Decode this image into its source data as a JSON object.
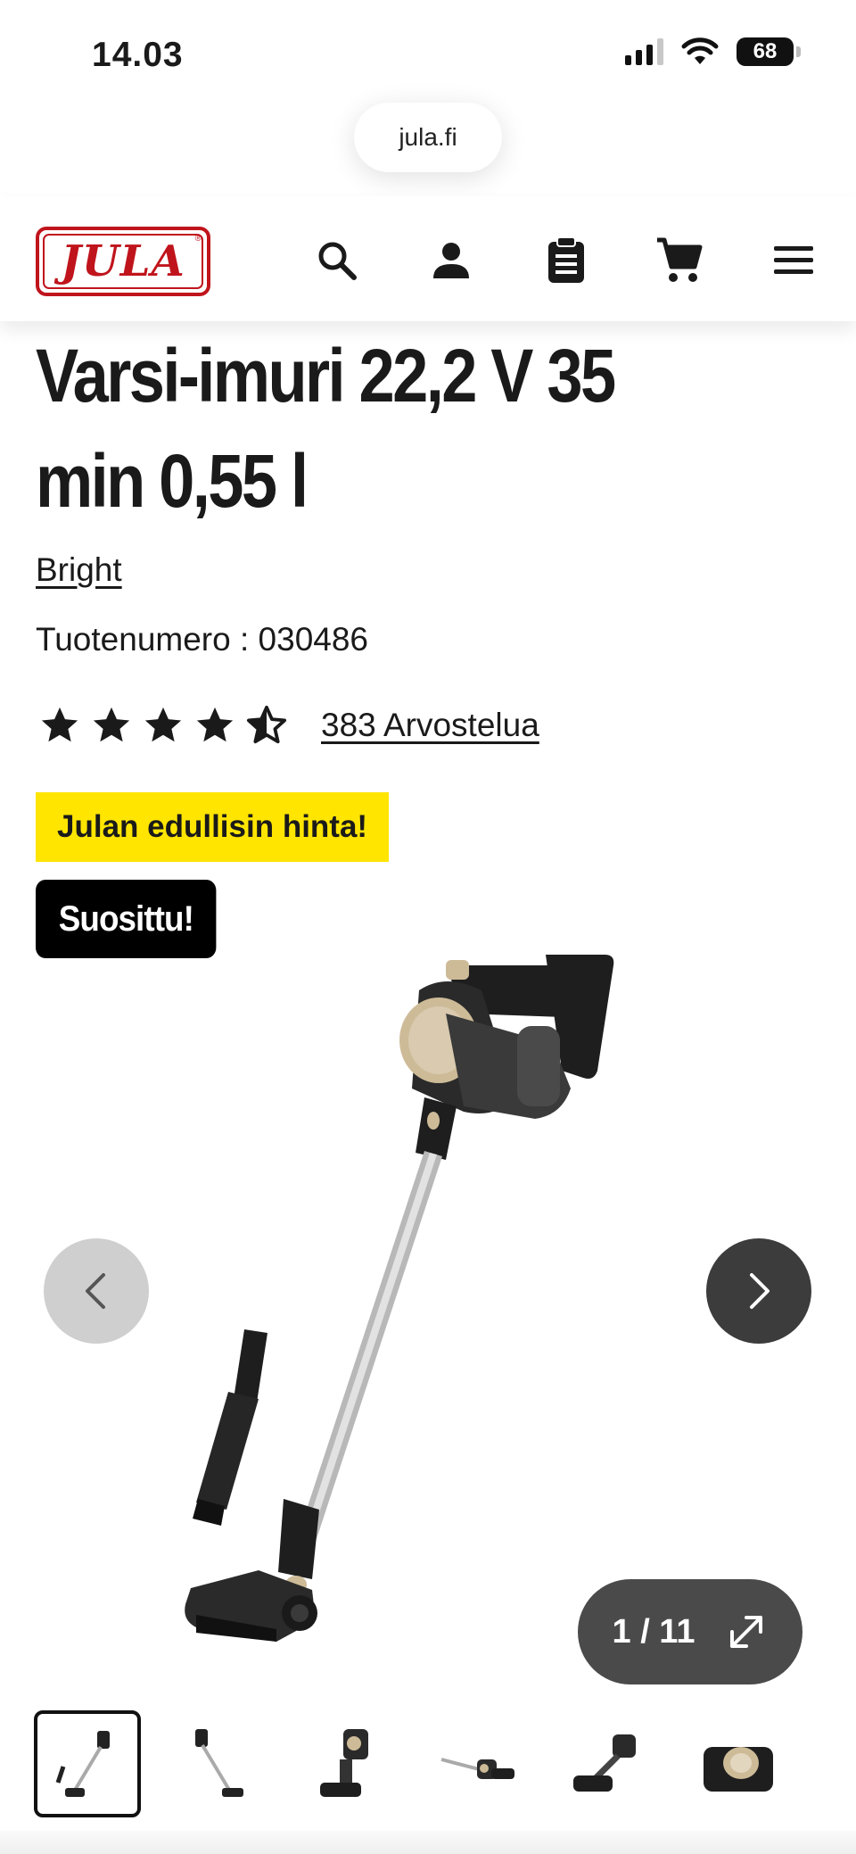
{
  "status_bar": {
    "time": "14.03",
    "battery": "68",
    "icons": [
      "cellular-signal-icon",
      "wifi-icon",
      "battery-icon"
    ]
  },
  "browser": {
    "url": "jula.fi"
  },
  "header": {
    "logo_text": "JULA",
    "logo_mark": "®",
    "icons": [
      "search-icon",
      "account-icon",
      "shopping-list-icon",
      "cart-icon",
      "menu-icon"
    ]
  },
  "product": {
    "title": "Varsi-imuri 22,2 V 35 min 0,55 l",
    "brand": "Bright",
    "sku_label": "Tuotenumero :",
    "sku_value": "030486",
    "rating": 4.5,
    "reviews_label": "383 Arvostelua",
    "badge_price": "Julan edullisin hinta!",
    "badge_popular": "Suosittu!"
  },
  "gallery": {
    "current": "1",
    "separator": "/",
    "total": "11",
    "counter_text": "1 / 11",
    "thumbnail_count": 7,
    "active_thumbnail": 1
  },
  "colors": {
    "brand_red": "#c0141c",
    "badge_yellow": "#ffe500",
    "badge_black": "#000000",
    "nav_next_bg": "#3c3c3c",
    "nav_prev_bg": "#cfcfcf"
  }
}
